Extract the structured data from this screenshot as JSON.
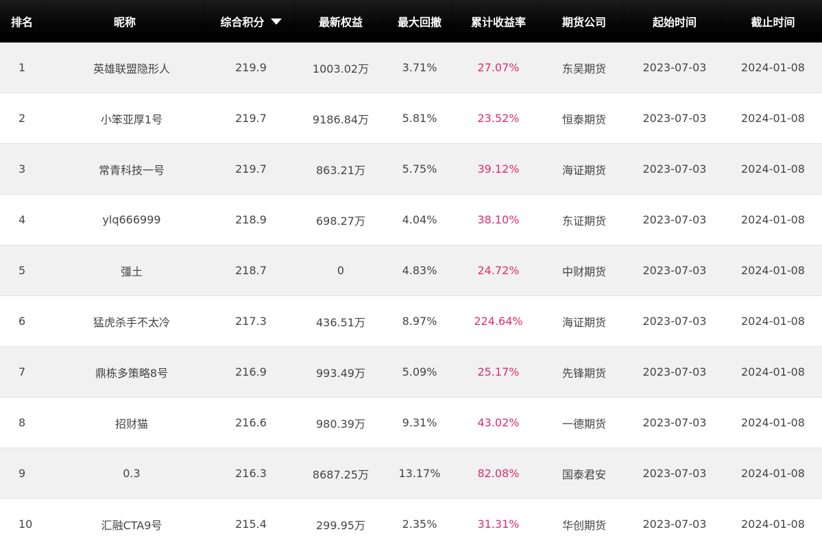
{
  "header": {
    "rank": "排名",
    "name": "昵称",
    "score": "综合积分",
    "equity": "最新权益",
    "drawdown": "最大回撤",
    "return": "累计收益率",
    "broker": "期货公司",
    "start": "起始时间",
    "end": "截止时间",
    "sort_icon": "caret-down-icon"
  },
  "colors": {
    "header_bg": "#000000",
    "header_text": "#ffffff",
    "row_alt": "#f1f1f1",
    "return_text": "#e02b6f",
    "body_text": "#444444"
  },
  "rows": [
    {
      "rank": "1",
      "name": "英雄联盟隐形人",
      "score": "219.9",
      "equity": "1003.02万",
      "drawdown": "3.71%",
      "return": "27.07%",
      "broker": "东吴期货",
      "start": "2023-07-03",
      "end": "2024-01-08"
    },
    {
      "rank": "2",
      "name": "小笨亚厚1号",
      "score": "219.7",
      "equity": "9186.84万",
      "drawdown": "5.81%",
      "return": "23.52%",
      "broker": "恒泰期货",
      "start": "2023-07-03",
      "end": "2024-01-08"
    },
    {
      "rank": "3",
      "name": "常青科技一号",
      "score": "219.7",
      "equity": "863.21万",
      "drawdown": "5.75%",
      "return": "39.12%",
      "broker": "海证期货",
      "start": "2023-07-03",
      "end": "2024-01-08"
    },
    {
      "rank": "4",
      "name": "ylq666999",
      "score": "218.9",
      "equity": "698.27万",
      "drawdown": "4.04%",
      "return": "38.10%",
      "broker": "东证期货",
      "start": "2023-07-03",
      "end": "2024-01-08"
    },
    {
      "rank": "5",
      "name": "彊土",
      "score": "218.7",
      "equity": "0",
      "drawdown": "4.83%",
      "return": "24.72%",
      "broker": "中财期货",
      "start": "2023-07-03",
      "end": "2024-01-08"
    },
    {
      "rank": "6",
      "name": "猛虎杀手不太冷",
      "score": "217.3",
      "equity": "436.51万",
      "drawdown": "8.97%",
      "return": "224.64%",
      "broker": "海证期货",
      "start": "2023-07-03",
      "end": "2024-01-08"
    },
    {
      "rank": "7",
      "name": "鼎栋多策略8号",
      "score": "216.9",
      "equity": "993.49万",
      "drawdown": "5.09%",
      "return": "25.17%",
      "broker": "先锋期货",
      "start": "2023-07-03",
      "end": "2024-01-08"
    },
    {
      "rank": "8",
      "name": "招财猫",
      "score": "216.6",
      "equity": "980.39万",
      "drawdown": "9.31%",
      "return": "43.02%",
      "broker": "一德期货",
      "start": "2023-07-03",
      "end": "2024-01-08"
    },
    {
      "rank": "9",
      "name": "0.3",
      "score": "216.3",
      "equity": "8687.25万",
      "drawdown": "13.17%",
      "return": "82.08%",
      "broker": "国泰君安",
      "start": "2023-07-03",
      "end": "2024-01-08"
    },
    {
      "rank": "10",
      "name": "汇融CTA9号",
      "score": "215.4",
      "equity": "299.95万",
      "drawdown": "2.35%",
      "return": "31.31%",
      "broker": "华创期货",
      "start": "2023-07-03",
      "end": "2024-01-08"
    }
  ]
}
